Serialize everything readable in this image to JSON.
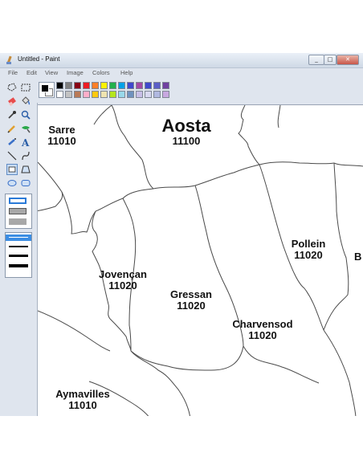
{
  "window": {
    "title": "Untitled - Paint",
    "controls": {
      "minimize": "_",
      "maximize": "□",
      "close": "✕"
    }
  },
  "menu": [
    "File",
    "Edit",
    "View",
    "Image",
    "Colors",
    "Help"
  ],
  "tools": [
    "free-form-select",
    "rectangle-select",
    "eraser",
    "fill-bucket",
    "color-picker",
    "magnifier",
    "pencil",
    "brush",
    "airbrush",
    "text",
    "line",
    "curve",
    "rectangle",
    "polygon",
    "ellipse",
    "rounded-rectangle"
  ],
  "colors": {
    "primary": "#000000",
    "secondary": "#ffffff",
    "palette_row1": [
      "#000000",
      "#808080",
      "#800000",
      "#808000",
      "#008000",
      "#008080",
      "#000080",
      "#800080",
      "#808040",
      "#004040",
      "#0080ff",
      "#004080",
      "#8000ff",
      "#804000"
    ],
    "palette_row1_display": [
      "#000000",
      "#7f7f7f",
      "#880015",
      "#ed1c24",
      "#ff7f27",
      "#fff200",
      "#22b14c",
      "#00a2e8",
      "#3f48cc",
      "#a349a4",
      "#3f48cc",
      "#5b5fc7",
      "#7040a0"
    ],
    "palette_row2_display": [
      "#ffffff",
      "#c3c3c3",
      "#b97a57",
      "#ffaec9",
      "#ffc90e",
      "#efe4b0",
      "#b5e61d",
      "#99d9ea",
      "#7092be",
      "#c8bfe7",
      "#d8d8f0",
      "#b0b8e0",
      "#c8a8e0"
    ]
  },
  "map": {
    "communes": [
      {
        "name": "Aosta",
        "code": "11100"
      },
      {
        "name": "Sarre",
        "code": "11010"
      },
      {
        "name": "Jovençan",
        "code": "11020"
      },
      {
        "name": "Gressan",
        "code": "11020"
      },
      {
        "name": "Pollein",
        "code": "11020"
      },
      {
        "name": "Charvensod",
        "code": "11020"
      },
      {
        "name": "Aymavilles",
        "code": "11010"
      },
      {
        "name": "B",
        "code": ""
      }
    ]
  }
}
